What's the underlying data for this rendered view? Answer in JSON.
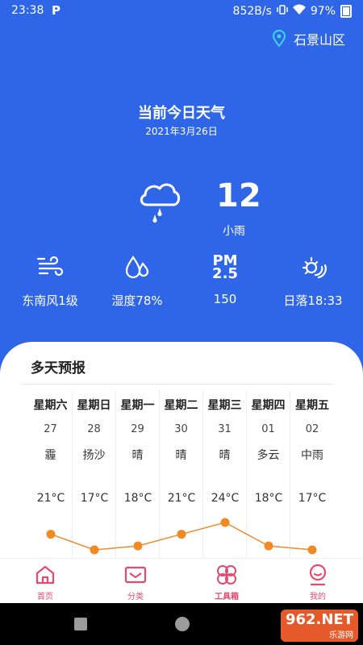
{
  "status": {
    "time": "23:38",
    "speed": "852B/s",
    "battery": "97%"
  },
  "location": {
    "name": "石景山区"
  },
  "header": {
    "title": "当前今日天气",
    "date": "2021年3月26日"
  },
  "current": {
    "temp": "12",
    "condition": "小雨"
  },
  "details": [
    {
      "icon": "wind-icon",
      "label": "东南风1级"
    },
    {
      "icon": "humidity-icon",
      "label": "湿度78%"
    },
    {
      "icon": "pm-icon",
      "icon_text_1": "PM",
      "icon_text_2": "2.5",
      "label": "150"
    },
    {
      "icon": "sunset-icon",
      "label": "日落18:33"
    }
  ],
  "forecast": {
    "title": "多天预报",
    "days": [
      {
        "name": "星期六",
        "date": "27",
        "condition": "霾",
        "temp": "21°C"
      },
      {
        "name": "星期日",
        "date": "28",
        "condition": "扬沙",
        "temp": "17°C"
      },
      {
        "name": "星期一",
        "date": "29",
        "condition": "晴",
        "temp": "18°C"
      },
      {
        "name": "星期二",
        "date": "30",
        "condition": "晴",
        "temp": "21°C"
      },
      {
        "name": "星期三",
        "date": "31",
        "condition": "晴",
        "temp": "24°C"
      },
      {
        "name": "星期四",
        "date": "01",
        "condition": "多云",
        "temp": "18°C"
      },
      {
        "name": "星期五",
        "date": "02",
        "condition": "中雨",
        "temp": "17°C"
      }
    ]
  },
  "chart_data": {
    "type": "line",
    "x": [
      "星期六",
      "星期日",
      "星期一",
      "星期二",
      "星期三",
      "星期四",
      "星期五"
    ],
    "values": [
      21,
      17,
      18,
      21,
      24,
      18,
      17
    ],
    "color": "#f08a24"
  },
  "tabs": [
    {
      "label": "首页",
      "icon": "home-icon"
    },
    {
      "label": "分类",
      "icon": "mail-icon"
    },
    {
      "label": "工具箱",
      "icon": "clover-icon",
      "active": true
    },
    {
      "label": "我的",
      "icon": "profile-icon"
    }
  ],
  "watermark": {
    "brand": "962.NET",
    "sub": "乐游网"
  },
  "colors": {
    "primary": "#2f66e8",
    "accent": "#e24a6e",
    "chart": "#f08a24"
  }
}
